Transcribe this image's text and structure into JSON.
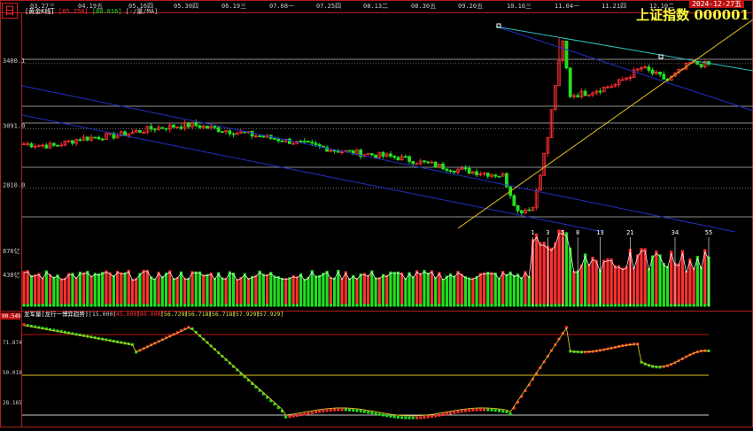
{
  "header": {
    "logo_glyph": "日",
    "title": "上证指数  000001",
    "date_badge": "2024-12-27五",
    "period_label": "[黄金K线]",
    "legend_red": "[85.250]",
    "legend_green": "[80.016]",
    "legend_other": "[·/量/MA]"
  },
  "time_axis": [
    "03.27三",
    "04.19五",
    "05.16四",
    "05.30四",
    "06.19三",
    "07.08一",
    "07.25四",
    "08.13二",
    "08.30五",
    "09.20五",
    "10.16三",
    "11.04一",
    "11.21四",
    "12.10二"
  ],
  "indicator_header": {
    "name": "龙军量[龙行一博弈趋势]",
    "values": [
      "[15.000]",
      "[45.000]",
      "[80.000]",
      "[56.729]",
      "[56.718]",
      "[56.718]",
      "[57.929]",
      "[57.929]"
    ]
  },
  "colors": {
    "up": "#ff3030",
    "down": "#20e020",
    "ma": "#ffffff",
    "trend": "#e0c020",
    "channel": "#2030c0",
    "upper": "#30c0c0"
  },
  "chart_data": [
    {
      "type": "candlestick",
      "title": "上证指数 000001",
      "y_ticks": [
        {
          "value": 3400,
          "label": "3400.1"
        },
        {
          "value": 3091,
          "label": "3091.0"
        },
        {
          "value": 2810,
          "label": "2810.0"
        }
      ],
      "ylim": [
        2620,
        3600
      ],
      "note": "daily candles 2024-03-27 to 2024-12-27, values read off the grid"
    },
    {
      "type": "bar",
      "name": "volume",
      "y_ticks": [
        "876亿",
        "438亿"
      ],
      "fib_labels": [
        "1",
        "3",
        "5",
        "8",
        "13",
        "21",
        "34",
        "55"
      ]
    },
    {
      "type": "line",
      "name": "龙军量",
      "y_ticks": [
        "90.549",
        "71.874",
        "50.019",
        "28.165"
      ],
      "ylim": [
        12,
        92
      ]
    }
  ]
}
